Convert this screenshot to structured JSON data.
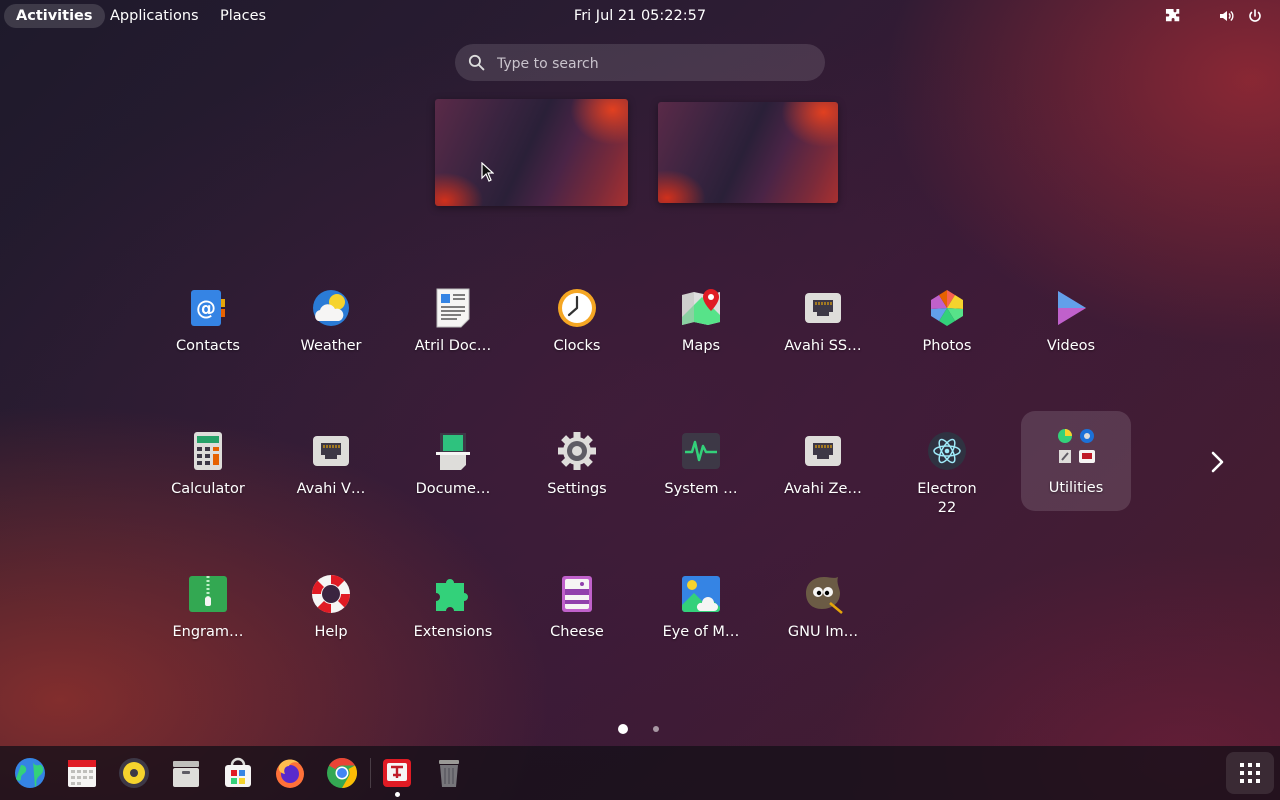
{
  "topbar": {
    "activities": "Activities",
    "applications": "Applications",
    "places": "Places",
    "clock": "Fri Jul 21  05:22:57"
  },
  "search": {
    "placeholder": "Type to search"
  },
  "apps": {
    "contacts": "Contacts",
    "weather": "Weather",
    "atril": "Atril Doc…",
    "clocks": "Clocks",
    "maps": "Maps",
    "avahi_ssh": "Avahi SS…",
    "photos": "Photos",
    "videos": "Videos",
    "calculator": "Calculator",
    "avahi_vnc": "Avahi V…",
    "document_scanner": "Docume…",
    "settings": "Settings",
    "system_monitor": "System …",
    "avahi_zeroconf": "Avahi Ze…",
    "electron_line1": "Electron",
    "electron_line2": "22",
    "utilities": "Utilities",
    "engrampa": "Engram…",
    "help": "Help",
    "extensions": "Extensions",
    "cheese": "Cheese",
    "eye_of_mate": "Eye of M…",
    "gimp": "GNU Im…"
  },
  "pagination": {
    "current_page": 1,
    "total_pages": 2
  },
  "colors": {
    "accent": "#3584e4",
    "panel": "#000000"
  }
}
